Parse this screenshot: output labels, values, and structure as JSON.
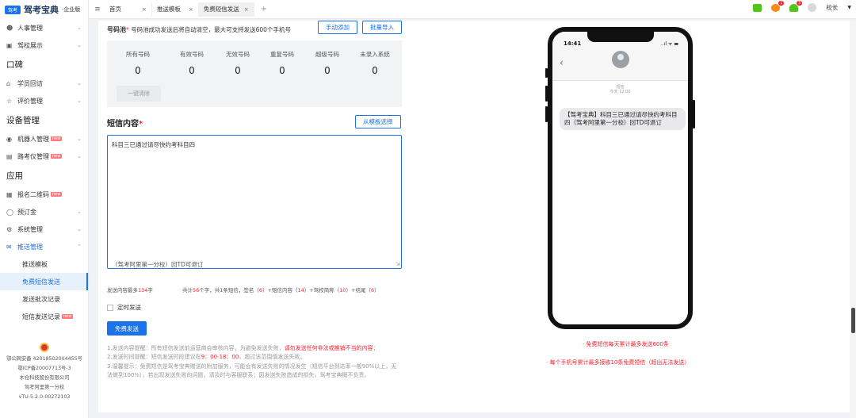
{
  "brand": {
    "name": "驾考宝典",
    "sub": "·企业版",
    "mark": "驾考"
  },
  "sidebar": {
    "items": [
      {
        "label": "人事管理",
        "icon": "person-icon"
      },
      {
        "label": "驾校展示",
        "icon": "display-icon"
      }
    ],
    "groups": [
      {
        "title": "口碑",
        "items": [
          {
            "label": "学员回访"
          },
          {
            "label": "评价管理"
          }
        ]
      },
      {
        "title": "设备管理",
        "items": [
          {
            "label": "机器人管理"
          },
          {
            "label": "路考仪管理"
          }
        ]
      },
      {
        "title": "应用",
        "items": [
          {
            "label": "报名二维码"
          },
          {
            "label": "预订金"
          },
          {
            "label": "系统管理"
          },
          {
            "label": "推送管理"
          }
        ]
      }
    ],
    "sub_items": [
      {
        "label": "推送模板"
      },
      {
        "label": "免费短信发送"
      },
      {
        "label": "发送批次记录"
      },
      {
        "label": "短信发送记录"
      }
    ],
    "new_badge": "new",
    "footer": [
      "鄂公网安备 42018502004455号",
      "鄂ICP备20007713号-3",
      "木仓科技股份有限公司",
      "驾考阿里第一分校",
      "vTU-5.2.0-00272103"
    ]
  },
  "tabs": [
    {
      "label": "首页"
    },
    {
      "label": "推送模板"
    },
    {
      "label": "免费短信发送"
    }
  ],
  "topbar": {
    "badge_1": "1",
    "badge_2": "5",
    "user": "校长"
  },
  "form": {
    "numbers_label": "号码池",
    "numbers_hint": "号码池成功发送后将自动清空，最大可支持发送600个手机号",
    "manual_add": "手动添加",
    "batch_import": "批量导入",
    "stats": [
      {
        "label": "所有号码",
        "value": "0"
      },
      {
        "label": "有效号码",
        "value": "0"
      },
      {
        "label": "无效号码",
        "value": "0"
      },
      {
        "label": "重复号码",
        "value": "0"
      },
      {
        "label": "超级号码",
        "value": "0"
      },
      {
        "label": "未录入系统",
        "value": "0"
      }
    ],
    "clear_all": "一键清除",
    "sms_label": "短信内容",
    "from_template": "从模板选择",
    "content": "科目三已通过请尽快约考科目四",
    "signature": "（驾考阿里第一分校）回TD可退订",
    "max_chars_prefix": "发送内容最多",
    "max_chars": "134",
    "max_chars_suffix": "字",
    "count_text_1": "共计",
    "count_total": "56",
    "count_text_2": "个字，共1条短信，签名（",
    "count_sign": "6",
    "count_text_3": "）+短信内容（",
    "count_content": "14",
    "count_text_4": "）+驾校简称（",
    "count_short": "10",
    "count_text_5": "）+结尾（",
    "count_end": "6",
    "count_text_6": "）",
    "schedule_label": "定时发送",
    "send": "免费发送",
    "notes": {
      "n1_prefix": "1.发送内容提醒：所有短信发送前运营商会审核内容，为避免发送失败，",
      "n1_red": "请勿发送任何非法或推销不当的内容",
      "n1_suffix": "；",
      "n2_prefix": "2.发送时间提醒：短信发送时段建议在",
      "n2_red": "9：00-18：00",
      "n2_suffix": "，超过该范围慎发送失败。",
      "n3": "3.温馨提示：免费短信是驾考宝典赠送的附加服务，可能会有发送失败的情况发生（短信平台到达率一般90%以上，无法做到100%），若出现发送失败的问题，请及时与客服联系；因发送失败造成的损失，驾考宝典概不负责。"
    }
  },
  "phone": {
    "time": "14:41",
    "status": "..ıl ᯤ ▬",
    "meta_1": "短信",
    "meta_2": "今天 12:00",
    "message": "【驾考宝典】科目三已通过请尽快约考科目四（驾考阿里第一分校）回TD可退订"
  },
  "limits": {
    "daily": "· 免费短信每天累计最多发送600条",
    "per_phone": "· 每个手机号累计最多接收10条免费短信（超出无法发送）"
  },
  "colors": {
    "accent": "#1a73e8",
    "danger": "#f5222d"
  }
}
